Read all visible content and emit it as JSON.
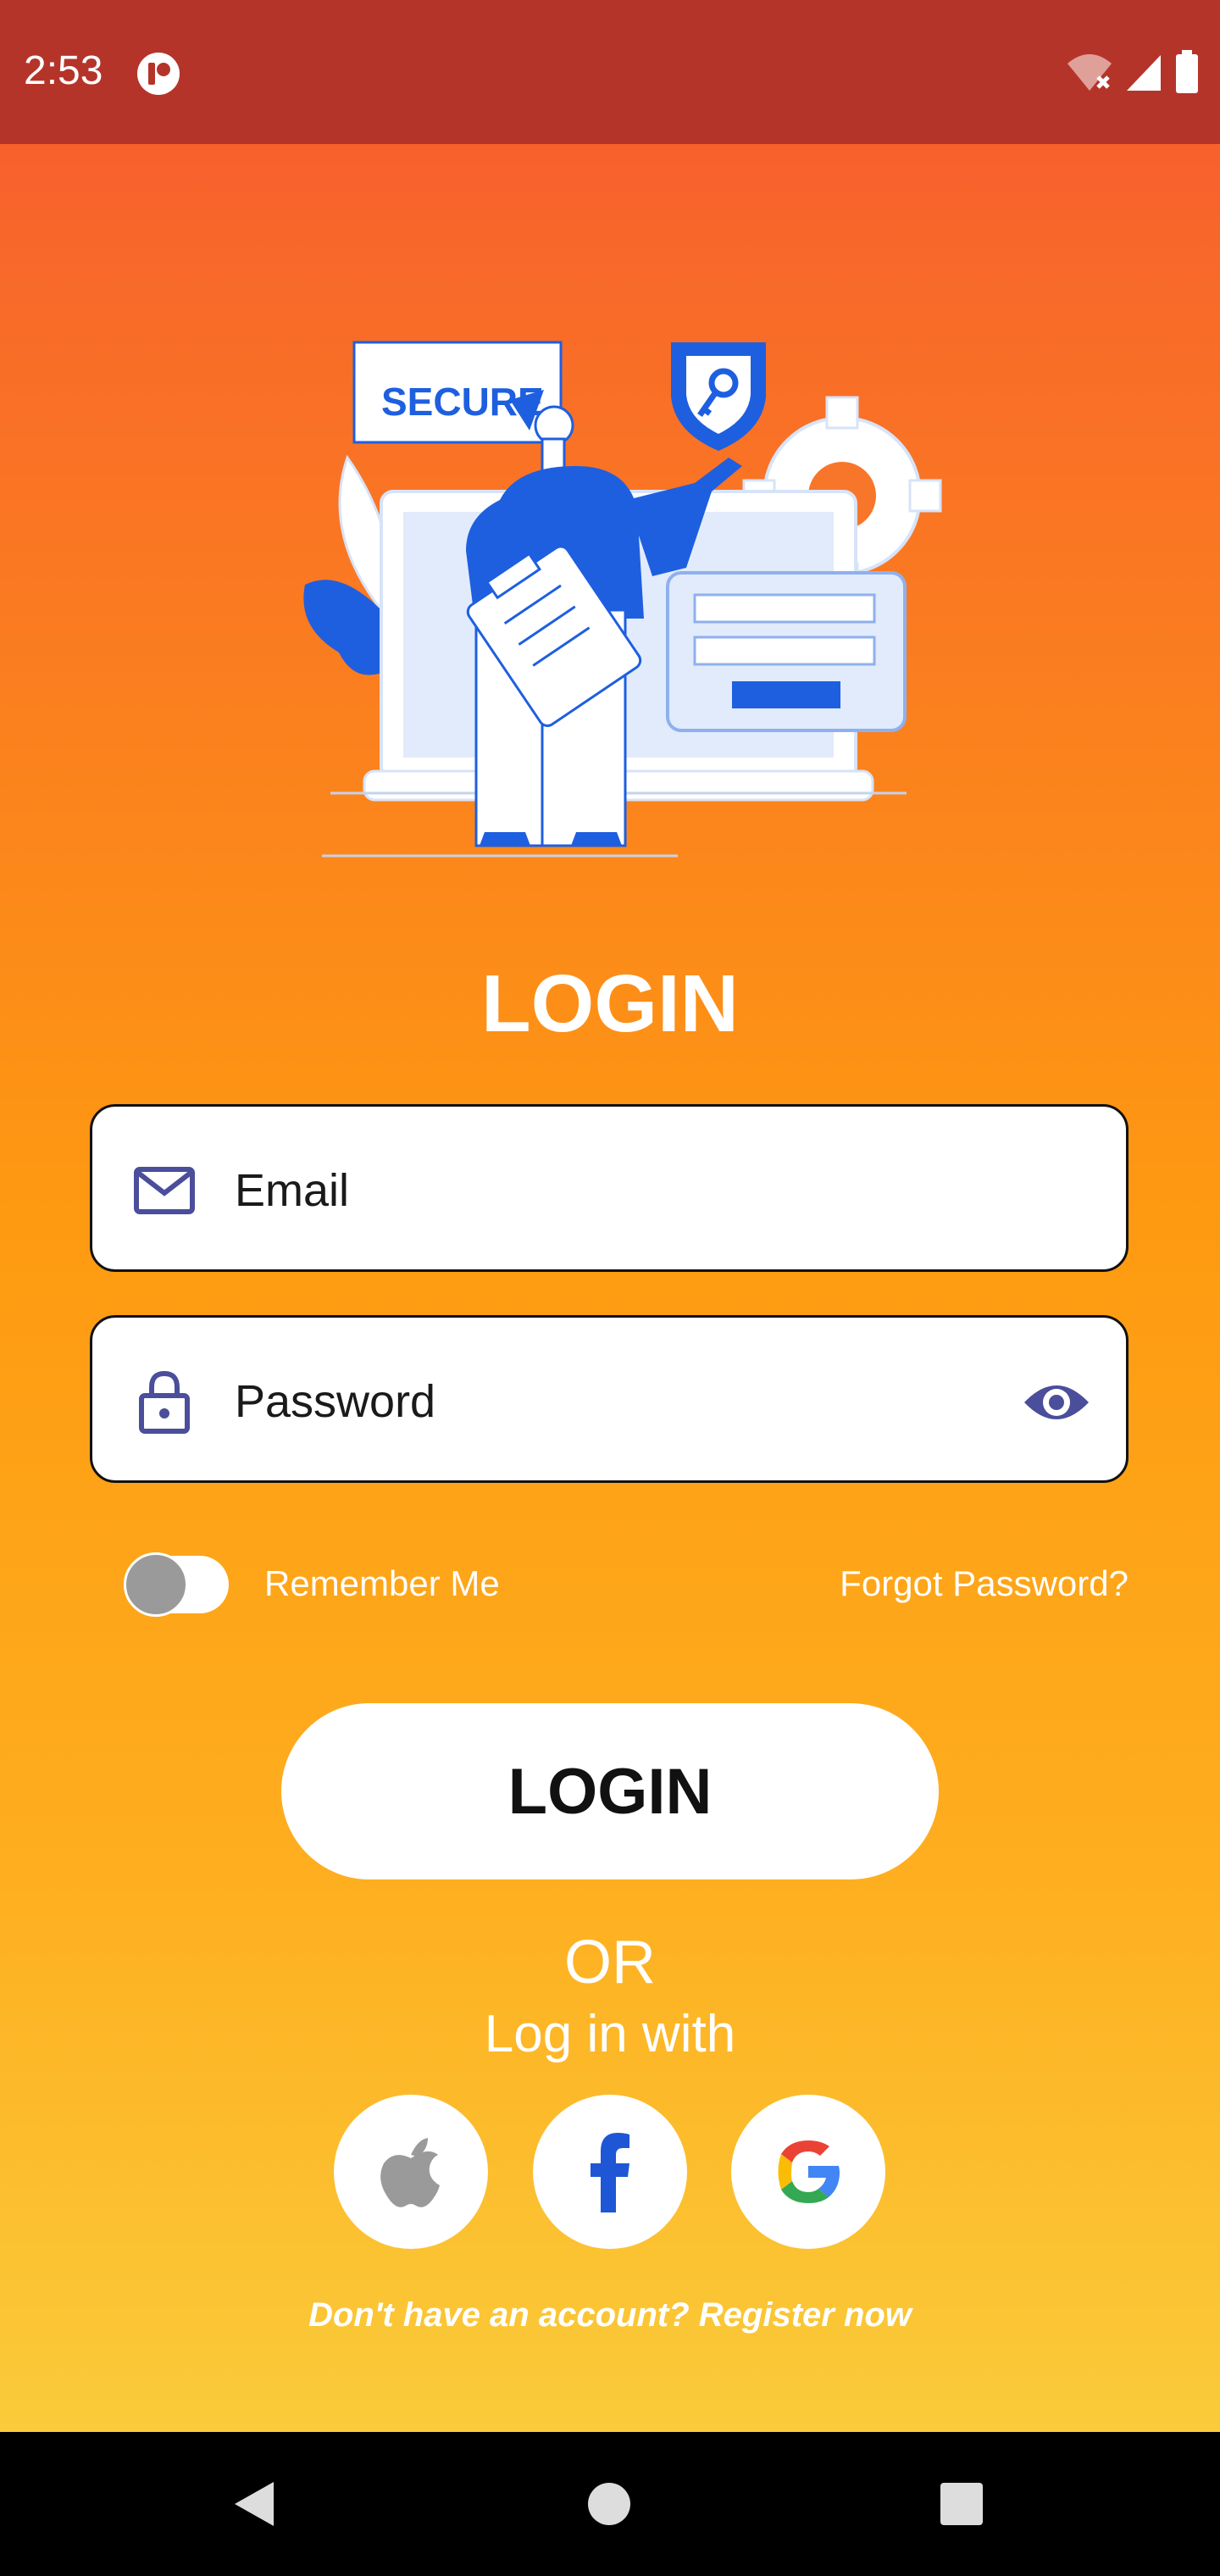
{
  "status_bar": {
    "time": "2:53"
  },
  "login": {
    "title": "LOGIN",
    "email": {
      "placeholder": "Email",
      "value": ""
    },
    "password": {
      "placeholder": "Password",
      "value": ""
    },
    "remember_me": {
      "label": "Remember Me",
      "enabled": false
    },
    "forgot_password": "Forgot Password?",
    "submit_label": "LOGIN",
    "or_text": "OR",
    "login_with_text": "Log in with",
    "social_icons": [
      "apple-icon",
      "facebook-icon",
      "google-icon"
    ],
    "register_prompt": "Don't have an account?",
    "register_link": "Register now"
  },
  "illustration": {
    "sign_text": "SECURE"
  },
  "colors": {
    "status_bar": "#B5342A",
    "gradient_top": "#F95530",
    "gradient_mid": "#FE9A11",
    "gradient_bottom": "#FACB3A",
    "icon_purple": "#4A4E9B",
    "illustration_blue": "#1E5FE0",
    "facebook_blue": "#1E56D6"
  }
}
